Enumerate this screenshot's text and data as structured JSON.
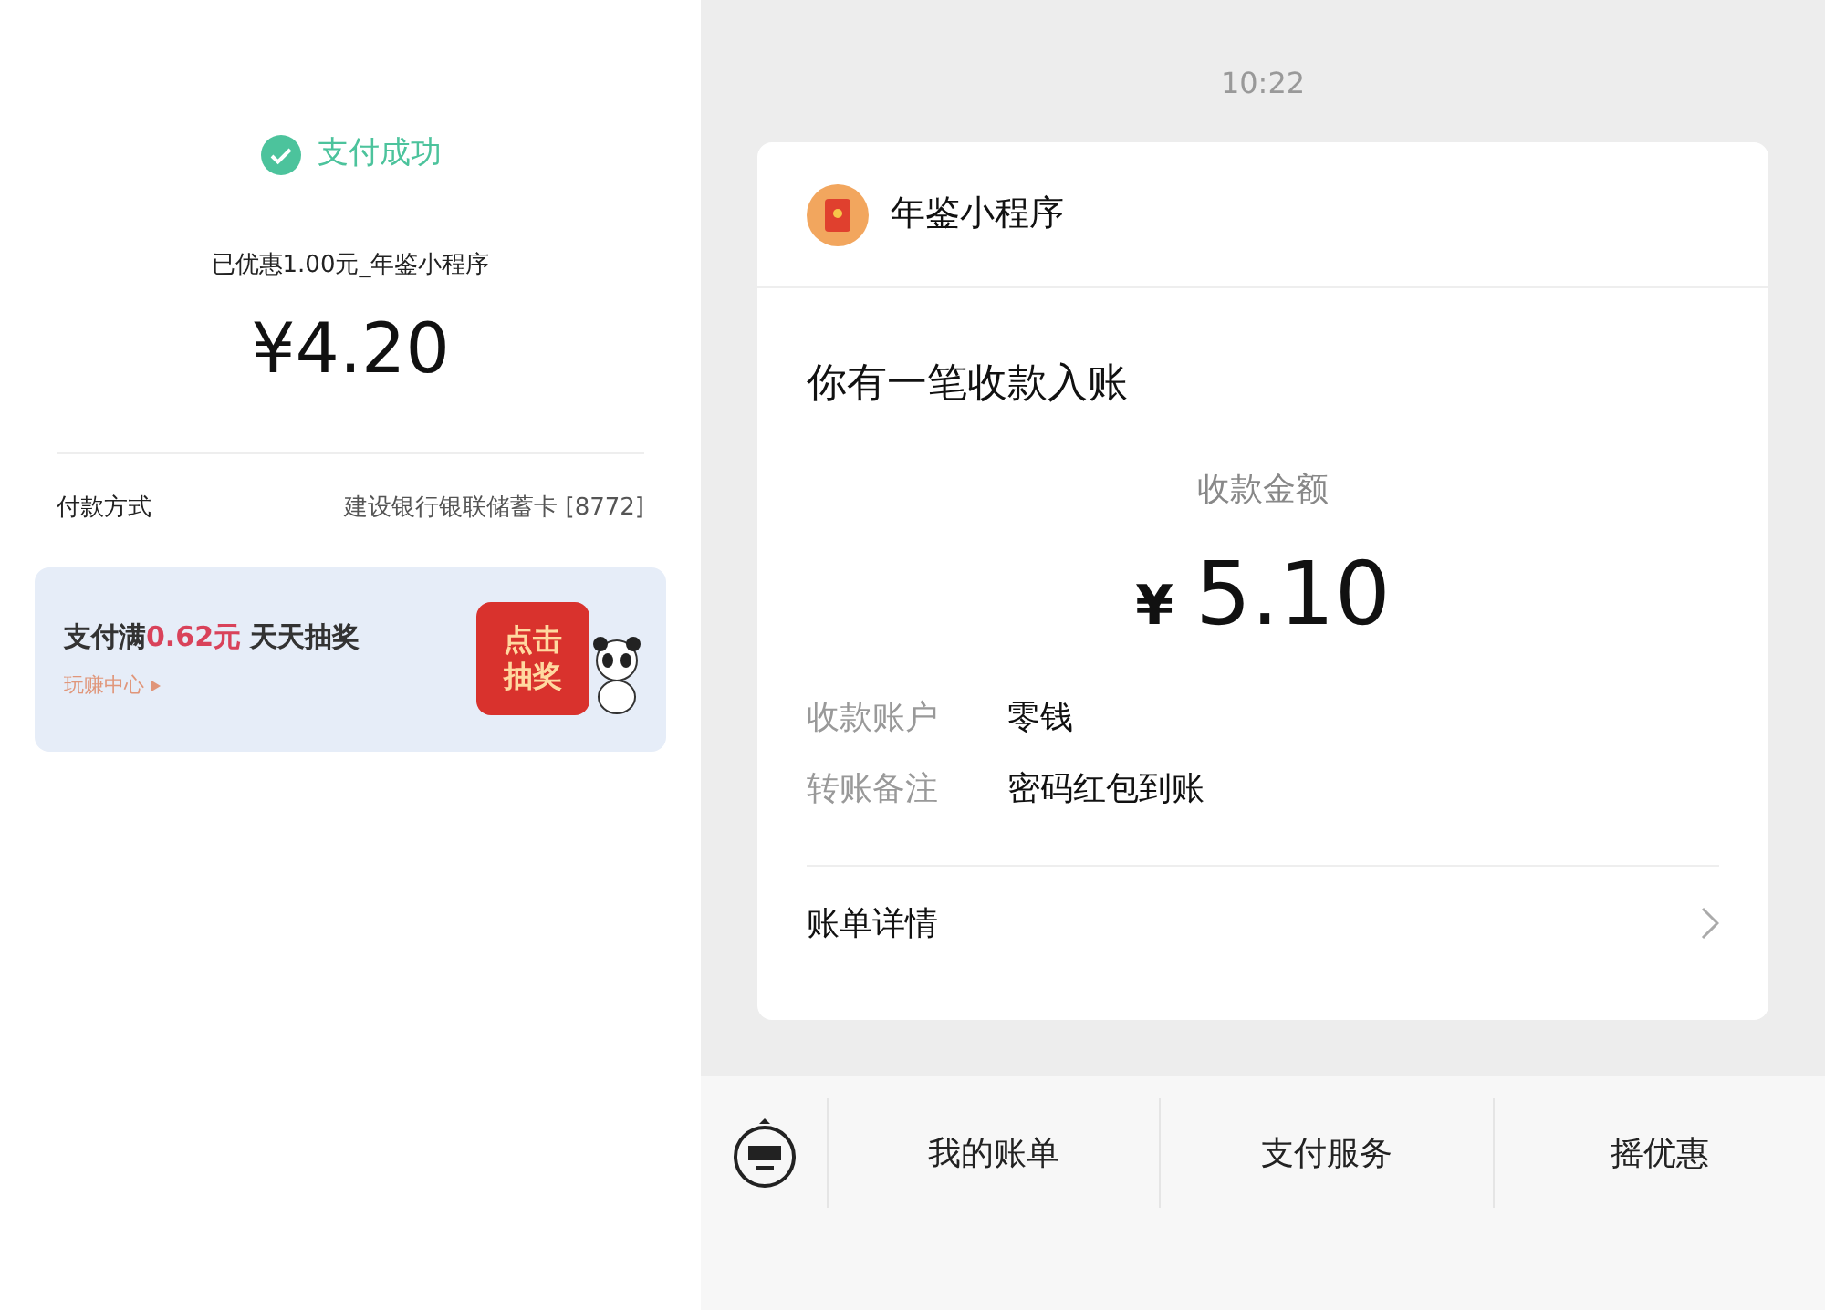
{
  "payment_result": {
    "status": "支付成功",
    "discount_note": "已优惠1.00元_年鉴小程序",
    "amount": "¥4.20",
    "method_label": "付款方式",
    "method_value": "建设银行银联储蓄卡 [8772]",
    "promo": {
      "text": "支付满**0.62元** 天天抽奖",
      "link": "玩赚中心",
      "button": "点击抽奖"
    }
  },
  "chat": {
    "time": "10:22",
    "message": {
      "sender": "年鉴小程序",
      "title": "你有一笔收款入账",
      "amount_label": "收款金额",
      "currency": "¥",
      "amount": "5.10",
      "fields": [
        {
          "label": "收款账户",
          "value": "零钱"
        },
        {
          "label": "转账备注",
          "value": "密码红包到账"
        }
      ],
      "details_link": "账单详情"
    }
  },
  "bottom_menu": {
    "items": [
      "我的账单",
      "支付服务",
      "摇优惠"
    ]
  }
}
